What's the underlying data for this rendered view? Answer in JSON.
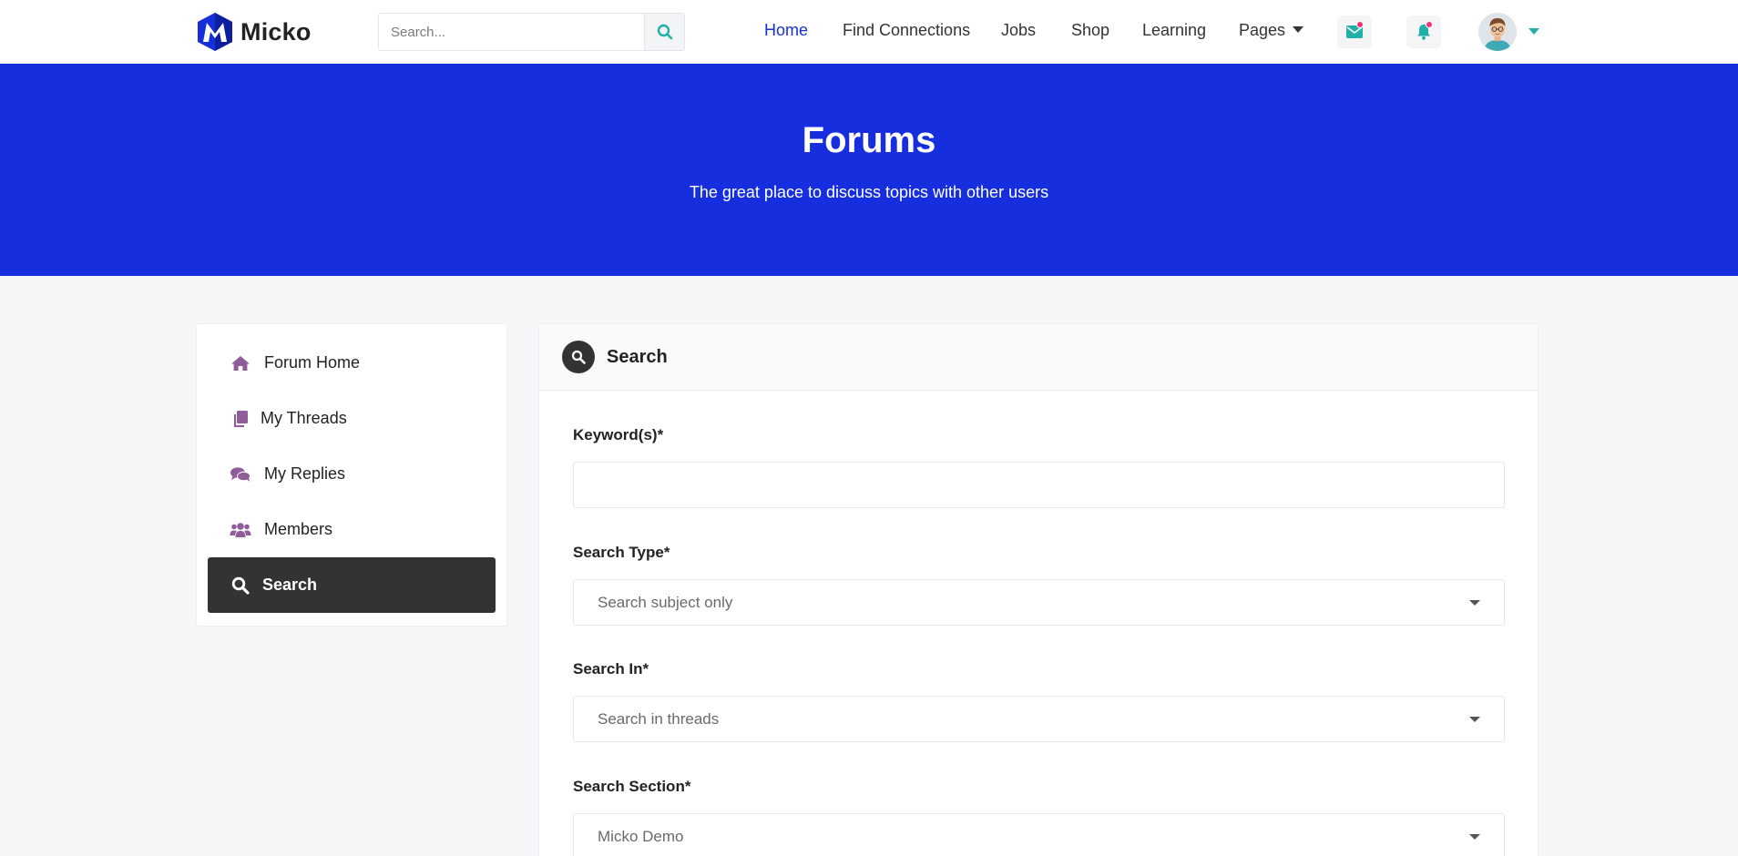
{
  "brand": {
    "name": "Micko"
  },
  "header": {
    "search_placeholder": "Search...",
    "nav": [
      {
        "label": "Home",
        "active": true
      },
      {
        "label": "Find Connections"
      },
      {
        "label": "Jobs"
      },
      {
        "label": "Shop"
      },
      {
        "label": "Learning"
      },
      {
        "label": "Pages",
        "has_dropdown": true
      }
    ],
    "icons": {
      "messages": "envelope-icon",
      "notifications": "bell-icon"
    }
  },
  "hero": {
    "title": "Forums",
    "subtitle": "The great place to discuss topics with other users"
  },
  "sidebar": {
    "items": [
      {
        "label": "Forum Home",
        "icon": "home-icon"
      },
      {
        "label": "My Threads",
        "icon": "documents-icon"
      },
      {
        "label": "My Replies",
        "icon": "comments-icon"
      },
      {
        "label": "Members",
        "icon": "users-icon"
      },
      {
        "label": "Search",
        "icon": "search-icon",
        "active": true
      }
    ]
  },
  "panel": {
    "title": "Search",
    "fields": {
      "keywords": {
        "label": "Keyword(s)*",
        "value": ""
      },
      "search_type": {
        "label": "Search Type*",
        "value": "Search subject only"
      },
      "search_in": {
        "label": "Search In*",
        "value": "Search in threads"
      },
      "search_section": {
        "label": "Search Section*",
        "value": "Micko Demo"
      }
    }
  },
  "colors": {
    "brand_blue": "#162edd",
    "accent_teal": "#20b0a8",
    "sidebar_icon": "#8e5d9a",
    "active_item": "#333333",
    "notification_dot": "#f5307a"
  }
}
